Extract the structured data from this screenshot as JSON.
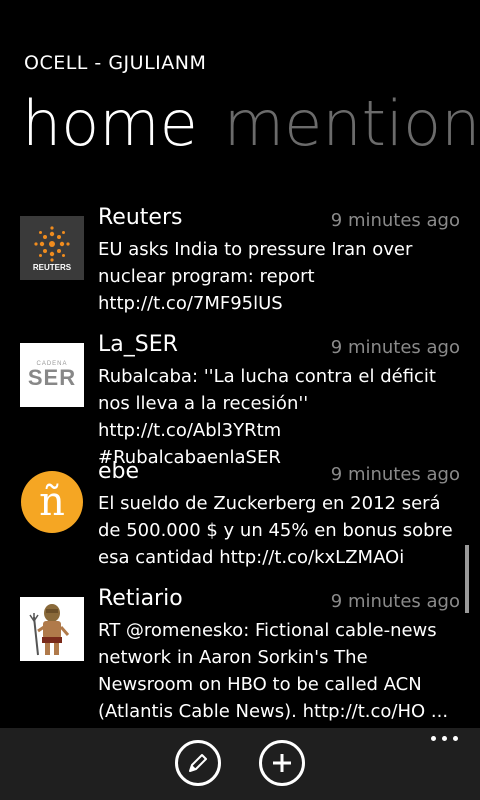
{
  "app": {
    "title": "OCELL - GJULIANM"
  },
  "pivot": {
    "active": "home",
    "next": "mention"
  },
  "tweets": [
    {
      "user": "Reuters",
      "time": "9 minutes ago",
      "text": "EU asks India to pressure Iran over nuclear program: report http://t.co/7MF95lUS",
      "avatar_label": "REUTERS"
    },
    {
      "user": "La_SER",
      "time": "9 minutes ago",
      "text": "Rubalcaba: ''La lucha contra el déficit nos lleva a la recesión'' http://t.co/Abl3YRtm #RubalcabaenlaSER",
      "avatar_label": "SER",
      "avatar_label_top": "CADENA"
    },
    {
      "user": "ebe",
      "time": "9 minutes ago",
      "text": "El sueldo de Zuckerberg en 2012 será de 500.000 $ y un 45% en bonus sobre esa cantidad http://t.co/kxLZMAOi",
      "avatar_label": "ñ"
    },
    {
      "user": "Retiario",
      "time": "9 minutes ago",
      "text": "RT @romenesko: Fictional cable-news network in Aaron Sorkin's The Newsroom on HBO to be called ACN (Atlantis Cable News). http://t.co/HO ...",
      "avatar_label": ""
    }
  ],
  "appbar": {
    "buttons": [
      {
        "icon": "pencil-icon"
      },
      {
        "icon": "plus-icon"
      }
    ],
    "more_icon": "more-dots-icon"
  },
  "colors": {
    "background": "#000000",
    "subtle": "#8a8a8a",
    "pivot_inactive": "#6b6b6b",
    "appbar": "#1f1f1f",
    "ebe_orange": "#f5a623"
  }
}
